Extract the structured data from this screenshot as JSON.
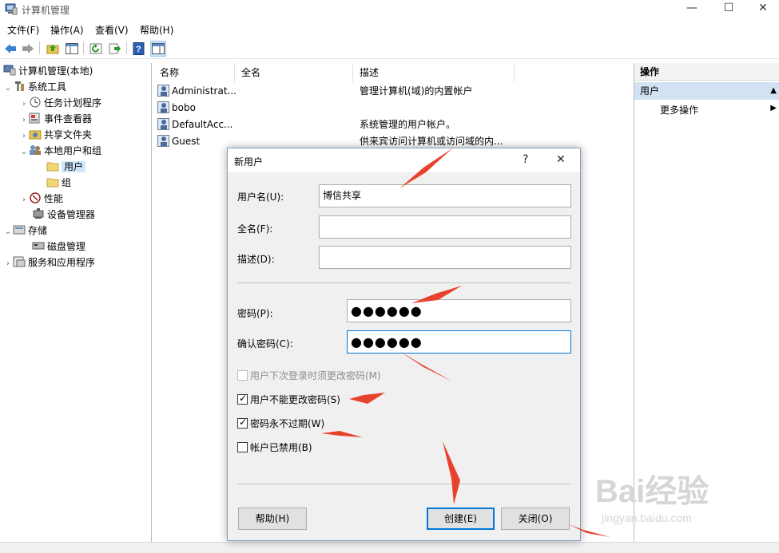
{
  "window": {
    "title": "计算机管理",
    "minimize": "—",
    "maximize": "☐",
    "close": "✕"
  },
  "menu": [
    "文件(F)",
    "操作(A)",
    "查看(V)",
    "帮助(H)"
  ],
  "tree": {
    "root": "计算机管理(本地)",
    "system_tools": "系统工具",
    "task_scheduler": "任务计划程序",
    "event_viewer": "事件查看器",
    "shared_folders": "共享文件夹",
    "local_users": "本地用户和组",
    "users": "用户",
    "groups": "组",
    "performance": "性能",
    "device_manager": "设备管理器",
    "storage": "存储",
    "disk_management": "磁盘管理",
    "services": "服务和应用程序"
  },
  "list": {
    "columns": [
      "名称",
      "全名",
      "描述"
    ],
    "rows": [
      {
        "name": "Administrat...",
        "fullname": "",
        "desc": "管理计算机(域)的内置帐户"
      },
      {
        "name": "bobo",
        "fullname": "",
        "desc": ""
      },
      {
        "name": "DefaultAcc...",
        "fullname": "",
        "desc": "系统管理的用户帐户。"
      },
      {
        "name": "Guest",
        "fullname": "",
        "desc": "供来宾访问计算机或访问域的内..."
      }
    ]
  },
  "actions": {
    "header": "操作",
    "section": "用户",
    "more": "更多操作"
  },
  "dialog": {
    "title": "新用户",
    "help_glyph": "?",
    "close_glyph": "✕",
    "username_label": "用户名(U):",
    "username_value": "博信共享",
    "fullname_label": "全名(F):",
    "fullname_value": "",
    "desc_label": "描述(D):",
    "desc_value": "",
    "password_label": "密码(P):",
    "password_value": "●●●●●●",
    "confirm_label": "确认密码(C):",
    "confirm_value": "●●●●●●",
    "chk_change_next": {
      "label": "用户下次登录时须更改密码(M)",
      "checked": false,
      "disabled": true
    },
    "chk_cannot_change": {
      "label": "用户不能更改密码(S)",
      "checked": true
    },
    "chk_never_expires": {
      "label": "密码永不过期(W)",
      "checked": true
    },
    "chk_disabled": {
      "label": "帐户已禁用(B)",
      "checked": false
    },
    "help_button": "帮助(H)",
    "create_button": "创建(E)",
    "close_button": "关闭(O)"
  },
  "watermark": {
    "brand": "Bai经验",
    "url": "jingyan.baidu.com"
  },
  "colors": {
    "accent": "#0078d7",
    "selection": "#cce8ff",
    "annotation_arrow": "#e8412c"
  }
}
